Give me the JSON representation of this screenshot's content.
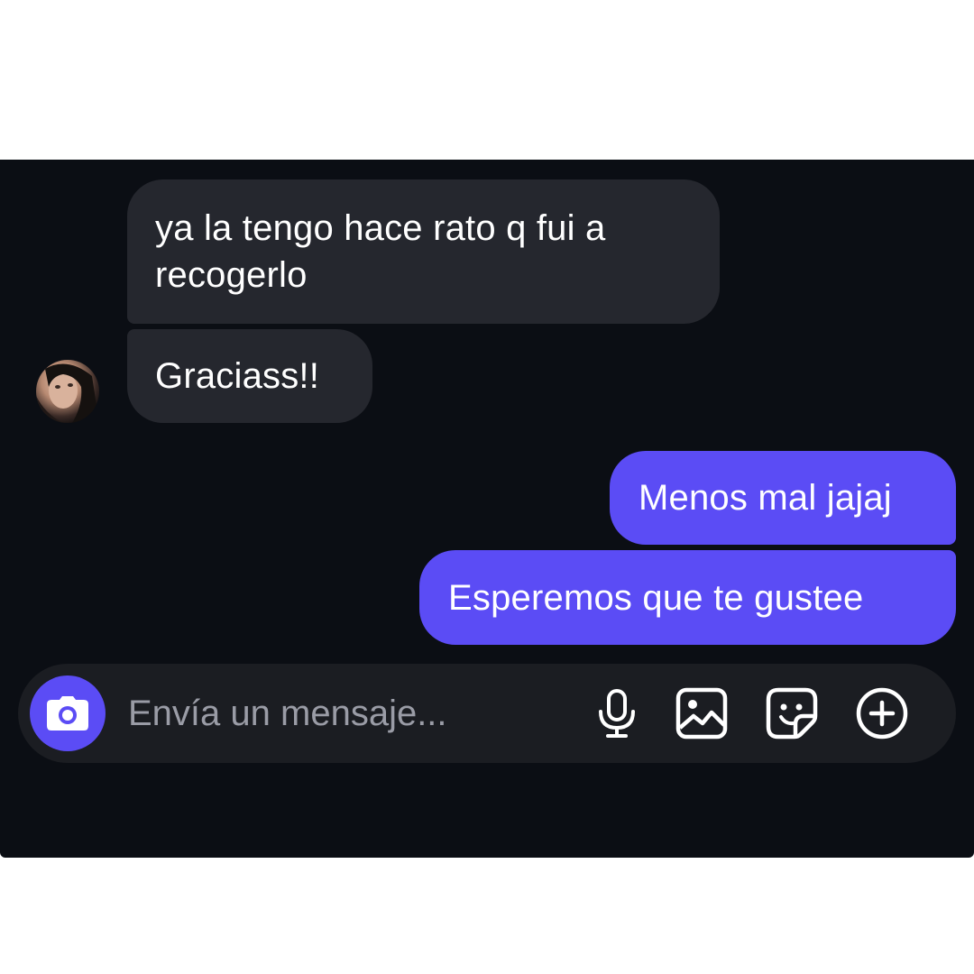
{
  "conversation": {
    "messages": [
      {
        "direction": "incoming",
        "text": "ya la tengo  hace rato q fui a recogerlo"
      },
      {
        "direction": "incoming",
        "text": "Graciass!!"
      },
      {
        "direction": "outgoing",
        "text": "Menos mal jajaj"
      },
      {
        "direction": "outgoing",
        "text": "Esperemos que te gustee"
      }
    ]
  },
  "composer": {
    "placeholder": "Envía un mensaje...",
    "value": "",
    "icons": [
      "camera-icon",
      "microphone-icon",
      "gallery-icon",
      "sticker-icon",
      "plus-circle-icon"
    ]
  },
  "colors": {
    "background": "#0b0e14",
    "incoming_bubble": "#25272e",
    "outgoing_bubble": "#5b4cf5",
    "composer": "#1b1d22",
    "accent": "#5b4cf5"
  }
}
